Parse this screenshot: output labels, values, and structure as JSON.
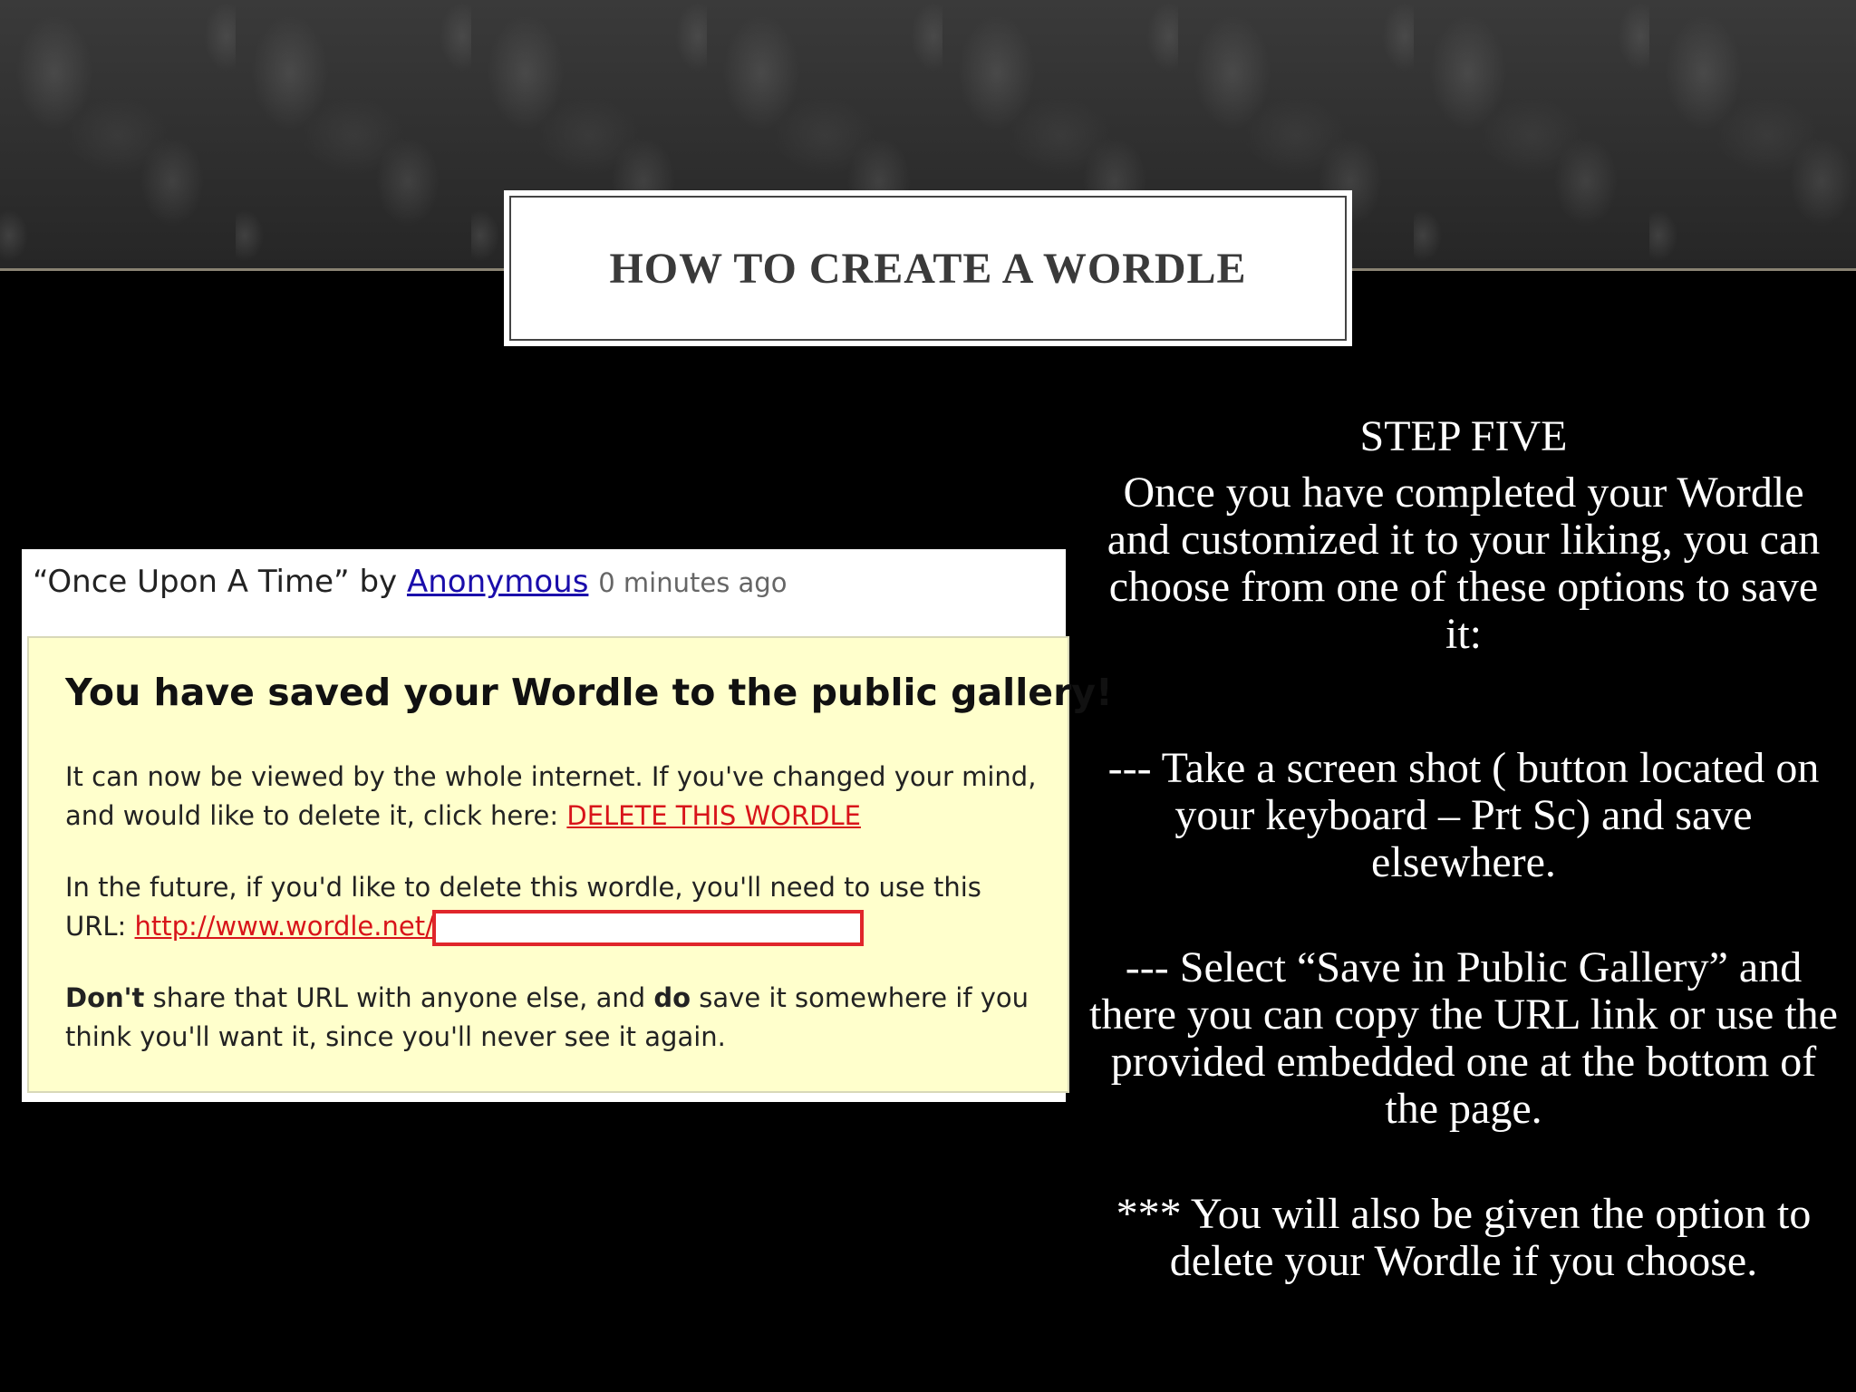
{
  "slide": {
    "title": "HOW TO CREATE A WORDLE"
  },
  "screenshot": {
    "header_prefix": "“Once Upon A Time” by ",
    "author": "Anonymous",
    "time_ago": "0 minutes ago",
    "notice_heading": "You have saved your Wordle to the public gallery!",
    "p1_text": "It can now be viewed by the whole internet. If you've changed your mind, and would like to delete it, click here: ",
    "delete_link": "DELETE THIS WORDLE",
    "p2_text": "In the future, if you'd like to delete this wordle, you'll need to use this URL: ",
    "url_link": "http://www.wordle.net/",
    "p3_bold1": "Don't",
    "p3_text1": " share that URL with anyone else, and ",
    "p3_bold2": "do",
    "p3_text2": " save it somewhere if you think you'll want it, since you'll never see it again."
  },
  "right_column": {
    "step_heading": "STEP FIVE",
    "intro": "Once you have completed your Wordle and customized it to your liking, you can choose from one of these options to save it:",
    "option1": "--- Take a screen shot ( button located on your keyboard – Prt Sc) and save elsewhere.",
    "option2": "--- Select “Save in Public Gallery” and there you can copy the URL link or use the provided embedded one at the bottom of the page.",
    "note": "*** You will also be given the option to delete your Wordle if you choose."
  },
  "colors": {
    "background": "#000000",
    "notice_bg": "#ffffcc",
    "link_red": "#d8141a",
    "link_blue": "#1a0dab",
    "highlight_box": "#e0262b"
  }
}
